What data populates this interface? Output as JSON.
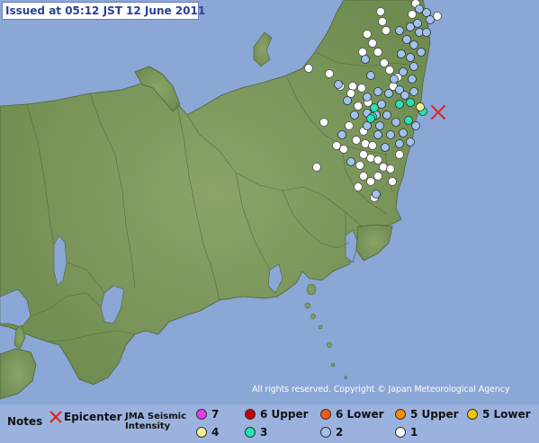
{
  "header": {
    "issued": "Issued at 05:12 JST  12 June 2011"
  },
  "copyright": "All rights reserved. Copyright © Japan Meteorological Agency",
  "legend": {
    "notes_label": "Notes",
    "epicenter_label": "Epicenter",
    "jma_line1": "JMA Seismic",
    "jma_line2": "Intensity",
    "intensities": [
      {
        "label": "7",
        "color": "#e43ce4"
      },
      {
        "label": "6 Upper",
        "color": "#c80000"
      },
      {
        "label": "6 Lower",
        "color": "#f05a14"
      },
      {
        "label": "5 Upper",
        "color": "#ff8c00"
      },
      {
        "label": "5 Lower",
        "color": "#f0c800"
      },
      {
        "label": "4",
        "color": "#f5f096"
      },
      {
        "label": "3",
        "color": "#22e6b4"
      },
      {
        "label": "2",
        "color": "#9fc3ee"
      },
      {
        "label": "1",
        "color": "#ffffff"
      }
    ]
  },
  "colors": {
    "sea": "#8aa7d6",
    "land": "#7f9a5f",
    "epicenter": "#e02020"
  },
  "observations": {
    "intensity_4": 1,
    "intensity_3": 7,
    "intensity_2_and_1": "many"
  }
}
